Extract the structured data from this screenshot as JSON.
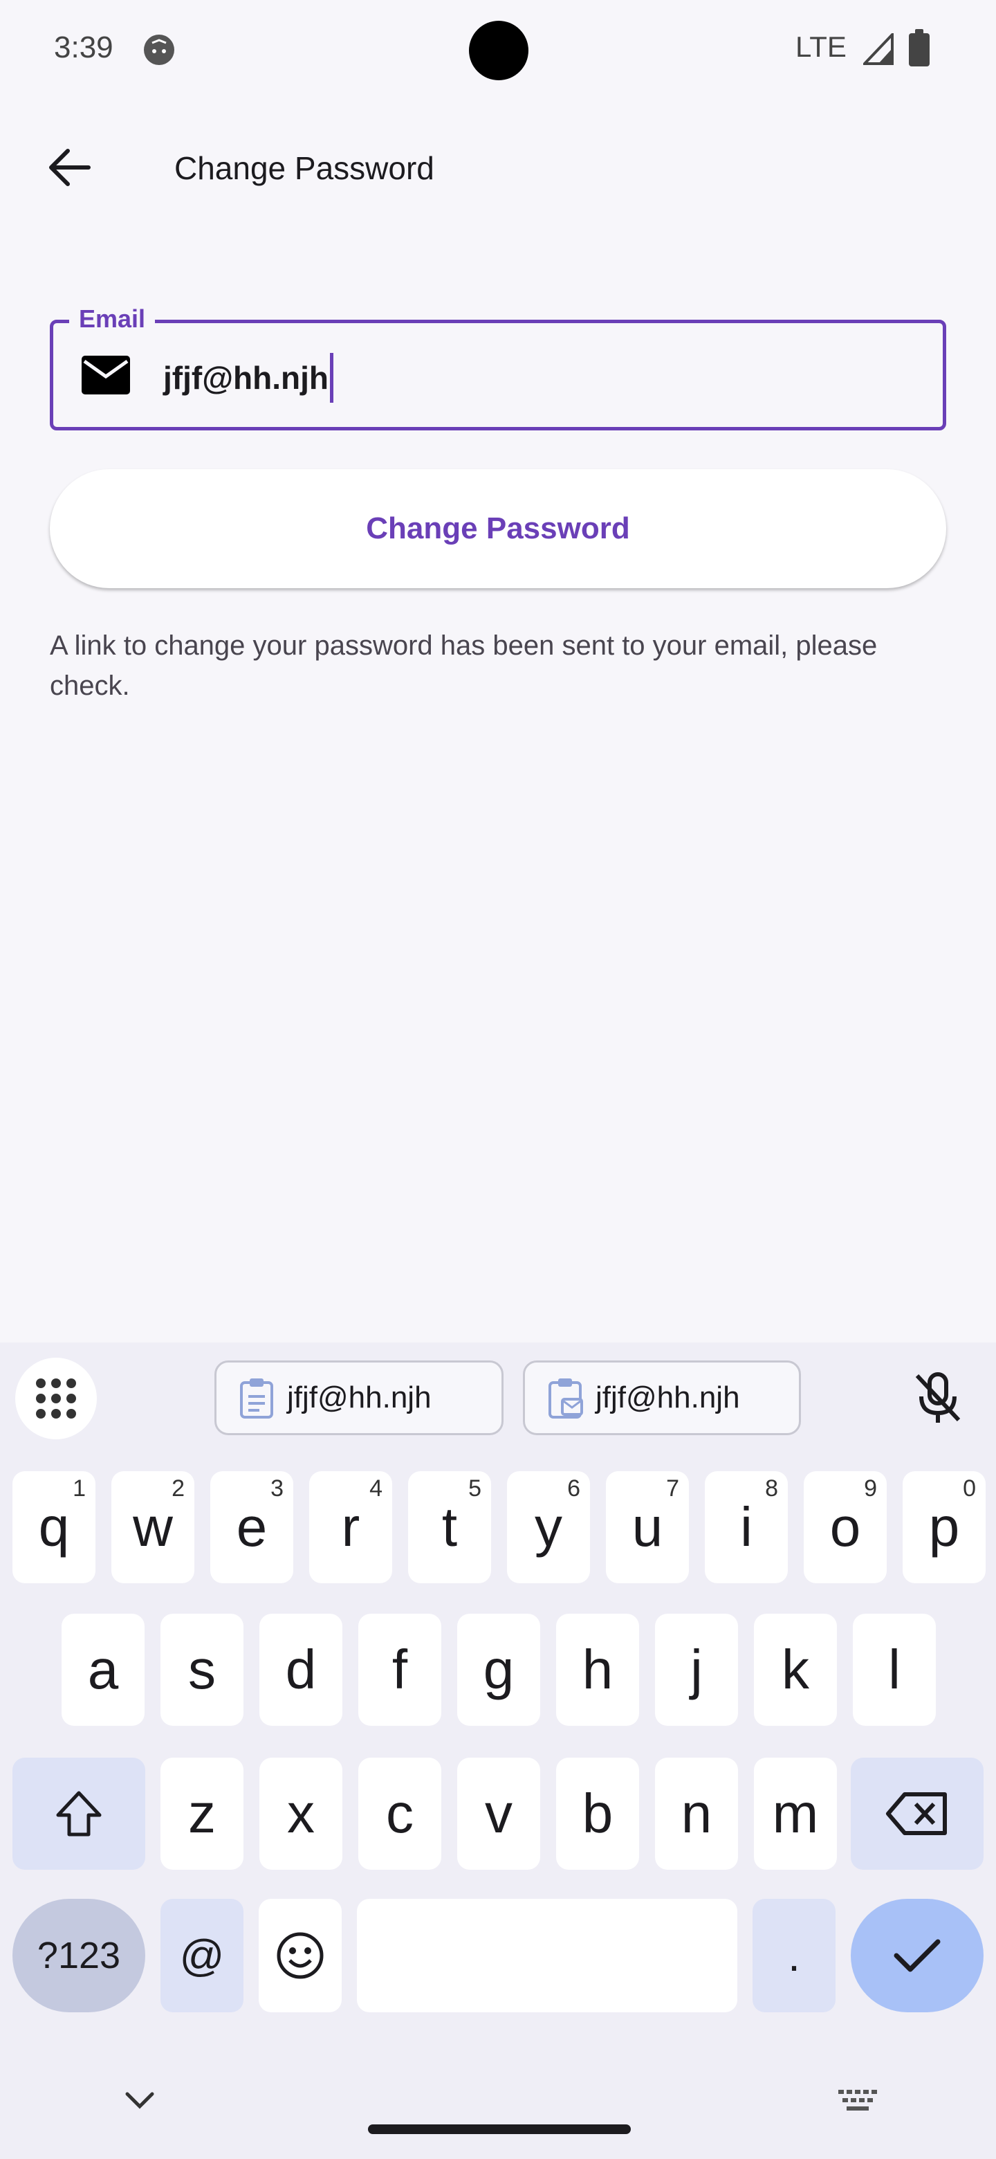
{
  "status_bar": {
    "time": "3:39",
    "network": "LTE"
  },
  "app_bar": {
    "title": "Change Password"
  },
  "email_field": {
    "label": "Email",
    "value": "jfjf@hh.njh"
  },
  "change_button": {
    "label": "Change Password"
  },
  "info_message": "A link to change your password  has been sent to your email, please check.",
  "keyboard": {
    "suggestions": [
      "jfjf@hh.njh",
      "jfjf@hh.njh"
    ],
    "row1": [
      {
        "k": "q",
        "h": "1"
      },
      {
        "k": "w",
        "h": "2"
      },
      {
        "k": "e",
        "h": "3"
      },
      {
        "k": "r",
        "h": "4"
      },
      {
        "k": "t",
        "h": "5"
      },
      {
        "k": "y",
        "h": "6"
      },
      {
        "k": "u",
        "h": "7"
      },
      {
        "k": "i",
        "h": "8"
      },
      {
        "k": "o",
        "h": "9"
      },
      {
        "k": "p",
        "h": "0"
      }
    ],
    "row2": [
      "a",
      "s",
      "d",
      "f",
      "g",
      "h",
      "j",
      "k",
      "l"
    ],
    "row3": [
      "z",
      "x",
      "c",
      "v",
      "b",
      "n",
      "m"
    ],
    "symbols_label": "?123",
    "at_label": "@",
    "period_label": "."
  },
  "colors": {
    "accent": "#6a3fb7",
    "background": "#f7f6fa",
    "keyboard_bg": "#efeef6",
    "modifier_key": "#dde2f6",
    "enter_key": "#a8c1f7"
  }
}
